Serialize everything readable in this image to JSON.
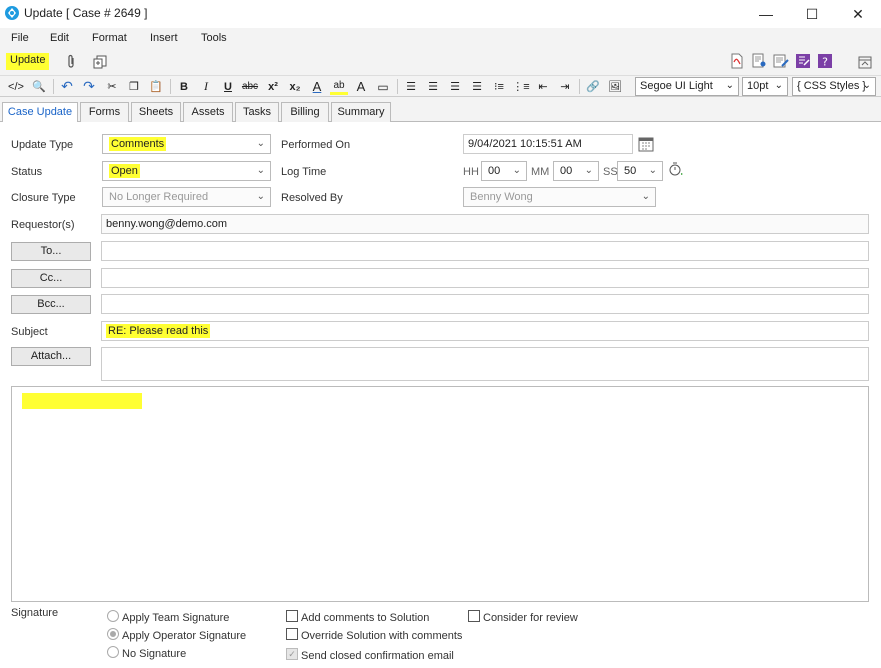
{
  "window": {
    "title": "Update [ Case # 2649 ]",
    "minimize": "—",
    "maximize": "☐",
    "close": "✕"
  },
  "menu": [
    "File",
    "Edit",
    "Format",
    "Insert",
    "Tools"
  ],
  "actions": {
    "update_label": "Update"
  },
  "format_bar": {
    "font": "Segoe UI Light",
    "size": "10pt",
    "css": "{ CSS Styles }",
    "icons": [
      "source-code-icon",
      "preview-icon",
      "undo-icon",
      "redo-icon",
      "cut-icon",
      "copy-icon",
      "paste-icon",
      "bold-icon",
      "italic-icon",
      "underline-icon",
      "strikethrough-icon",
      "superscript-icon",
      "subscript-icon",
      "font-color-icon",
      "highlight-icon",
      "font-size-icon",
      "horizontal-rule-icon",
      "align-left-icon",
      "align-center-icon",
      "align-right-icon",
      "justify-icon",
      "bullet-list-icon",
      "numbered-list-icon",
      "outdent-icon",
      "indent-icon",
      "link-icon",
      "image-icon"
    ]
  },
  "tabs": [
    "Case Update",
    "Forms",
    "Sheets",
    "Assets",
    "Tasks",
    "Billing",
    "Summary"
  ],
  "form": {
    "update_type": {
      "label": "Update Type",
      "value": "Comments"
    },
    "status": {
      "label": "Status",
      "value": "Open"
    },
    "closure_type": {
      "label": "Closure Type",
      "value": "No Longer Required"
    },
    "requestors": {
      "label": "Requestor(s)",
      "value": "benny.wong@demo.com"
    },
    "to": {
      "label": "To..."
    },
    "cc": {
      "label": "Cc..."
    },
    "bcc": {
      "label": "Bcc..."
    },
    "subject": {
      "label": "Subject",
      "value": "RE: Please read this"
    },
    "attach": {
      "label": "Attach..."
    },
    "performed_on": {
      "label": "Performed On",
      "value": "9/04/2021 10:15:51 AM"
    },
    "log_time": {
      "label": "Log Time",
      "hh_label": "HH",
      "hh": "00",
      "mm_label": "MM",
      "mm": "00",
      "ss_label": "SS",
      "ss": "50"
    },
    "resolved_by": {
      "label": "Resolved By",
      "value": "Benny Wong"
    }
  },
  "signature": {
    "label": "Signature",
    "options": [
      {
        "label": "Apply Team Signature",
        "checked": false
      },
      {
        "label": "Apply Operator Signature",
        "checked": true
      },
      {
        "label": "No Signature",
        "checked": false
      }
    ]
  },
  "checkboxes": {
    "add_comments": "Add comments to Solution",
    "override": "Override Solution with comments",
    "send_closed": "Send closed confirmation email",
    "consider": "Consider for review"
  },
  "colors": {
    "highlight": "#ffff33",
    "accent": "#1a64c8"
  }
}
